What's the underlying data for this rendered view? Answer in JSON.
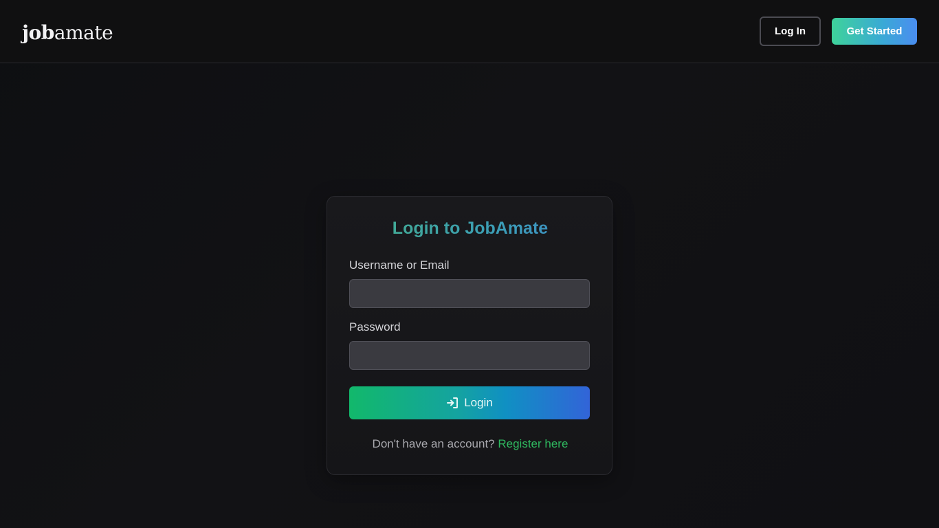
{
  "header": {
    "logo_part1": "job",
    "logo_part2": "amate",
    "login_label": "Log In",
    "get_started_label": "Get Started"
  },
  "login_card": {
    "title": "Login to JobAmate",
    "username_label": "Username or Email",
    "username_value": "",
    "password_label": "Password",
    "password_value": "",
    "submit_label": "Login",
    "submit_icon": "sign-in-icon",
    "signup_prompt": "Don't have an account?",
    "signup_link": "Register here"
  },
  "colors": {
    "accent_green": "#2fb85f",
    "accent_blue": "#3264d8",
    "background": "#0f0f11"
  }
}
